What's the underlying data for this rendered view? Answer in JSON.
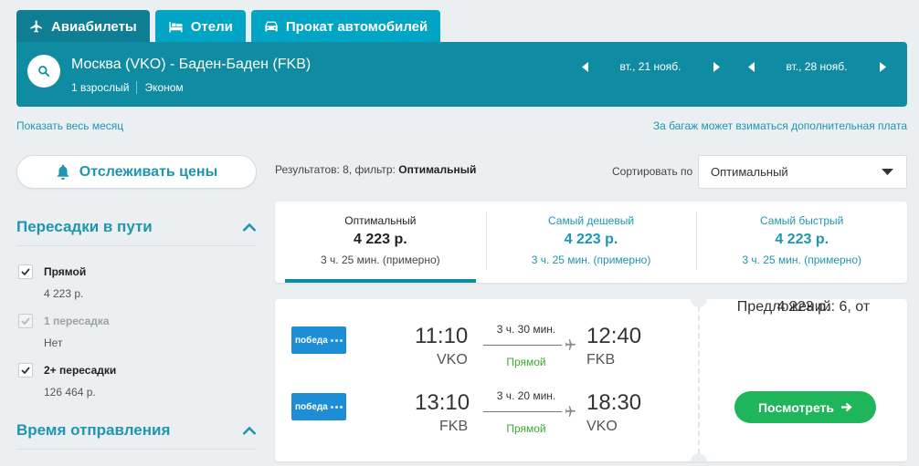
{
  "tabs": [
    {
      "label": "Авиабилеты",
      "icon": "plane-icon"
    },
    {
      "label": "Отели",
      "icon": "bed-icon"
    },
    {
      "label": "Прокат автомобилей",
      "icon": "car-icon"
    }
  ],
  "search": {
    "route": "Москва (VKO) - Баден-Баден (FKB)",
    "passengers": "1 взрослый",
    "class": "Эконом",
    "depart_date": "вт., 21 нояб.",
    "return_date": "вт., 28 нояб."
  },
  "links": {
    "show_month": "Показать весь месяц",
    "baggage_fee": "За багаж может взиматься дополнительная плата"
  },
  "filters": {
    "track_prices": "Отслеживать цены",
    "stops_title": "Пересадки в пути",
    "stops": [
      {
        "label": "Прямой",
        "price": "4 223 р.",
        "checked": true,
        "disabled": false
      },
      {
        "label": "1 пересадка",
        "price": "Нет",
        "checked": true,
        "disabled": true
      },
      {
        "label": "2+ пересадки",
        "price": "126 464 р.",
        "checked": true,
        "disabled": false
      }
    ],
    "departure_title": "Время отправления"
  },
  "results": {
    "prefix": "Результатов: 8, фильтр:",
    "filter": "Оптимальный",
    "sort_label": "Сортировать по",
    "sort_value": "Оптимальный"
  },
  "sort_tabs": [
    {
      "title": "Оптимальный",
      "price": "4 223 р.",
      "duration": "3 ч. 25 мин. (примерно)",
      "active": true
    },
    {
      "title": "Самый дешевый",
      "price": "4 223 р.",
      "duration": "3 ч. 25 мин. (примерно)",
      "active": false
    },
    {
      "title": "Самый быстрый",
      "price": "4 223 р.",
      "duration": "3 ч. 25 мин. (примерно)",
      "active": false
    }
  ],
  "ticket": {
    "segments": [
      {
        "airline": "победа",
        "dep_time": "11:10",
        "dep_code": "VKO",
        "duration": "3 ч. 30 мин.",
        "stops": "Прямой",
        "arr_time": "12:40",
        "arr_code": "FKB"
      },
      {
        "airline": "победа",
        "dep_time": "13:10",
        "dep_code": "FKB",
        "duration": "3 ч. 20 мин.",
        "stops": "Прямой",
        "arr_time": "18:30",
        "arr_code": "VKO"
      }
    ],
    "offers": "Предложений: 6, от",
    "price": "4 223 р.",
    "button": "Посмотреть"
  },
  "colors": {
    "header": "#0f8ba2",
    "tab": "#00a5c5",
    "accent": "#1e96b0",
    "green": "#1fb55a"
  }
}
